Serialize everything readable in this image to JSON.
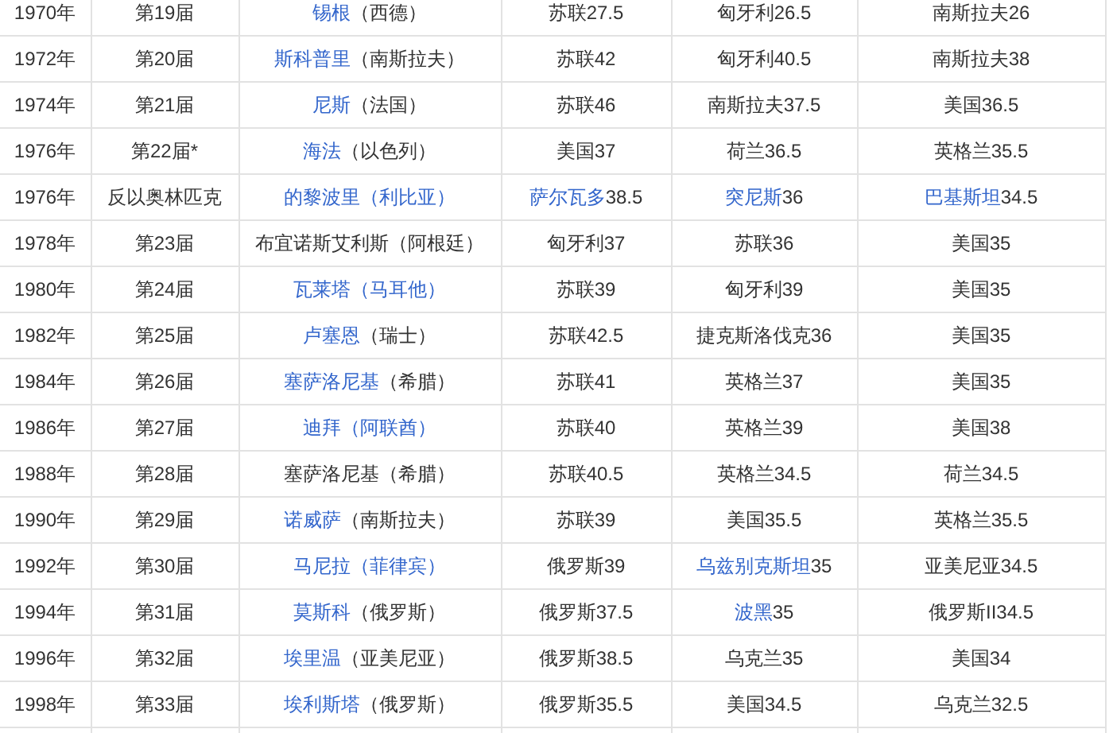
{
  "table": {
    "rows": [
      {
        "year": "1970年",
        "edition": "第19届",
        "city": "锡根",
        "city_link": true,
        "country": "（西德）",
        "country_link": false,
        "gold": {
          "team": "苏联",
          "score": "27.5",
          "link": false
        },
        "silver": {
          "team": "匈牙利",
          "score": "26.5",
          "link": false
        },
        "bronze": {
          "team": "南斯拉夫",
          "score": "26",
          "link": false
        }
      },
      {
        "year": "1972年",
        "edition": "第20届",
        "city": "斯科普里",
        "city_link": true,
        "country": "（南斯拉夫）",
        "country_link": false,
        "gold": {
          "team": "苏联",
          "score": "42",
          "link": false
        },
        "silver": {
          "team": "匈牙利",
          "score": "40.5",
          "link": false
        },
        "bronze": {
          "team": "南斯拉夫",
          "score": "38",
          "link": false
        }
      },
      {
        "year": "1974年",
        "edition": "第21届",
        "city": "尼斯",
        "city_link": true,
        "country": "（法国）",
        "country_link": false,
        "gold": {
          "team": "苏联",
          "score": "46",
          "link": false
        },
        "silver": {
          "team": "南斯拉夫",
          "score": "37.5",
          "link": false
        },
        "bronze": {
          "team": "美国",
          "score": "36.5",
          "link": false
        }
      },
      {
        "year": "1976年",
        "edition": "第22届*",
        "city": "海法",
        "city_link": true,
        "country": "（以色列）",
        "country_link": false,
        "gold": {
          "team": "美国",
          "score": "37",
          "link": false
        },
        "silver": {
          "team": "荷兰",
          "score": "36.5",
          "link": false
        },
        "bronze": {
          "team": "英格兰",
          "score": "35.5",
          "link": false
        }
      },
      {
        "year": "1976年",
        "edition": "反以奥林匹克",
        "city": "的黎波里",
        "city_link": true,
        "country": "（利比亚）",
        "country_link": true,
        "gold": {
          "team": "萨尔瓦多",
          "score": "38.5",
          "link": true
        },
        "silver": {
          "team": "突尼斯",
          "score": "36",
          "link": true
        },
        "bronze": {
          "team": "巴基斯坦",
          "score": "34.5",
          "link": true
        }
      },
      {
        "year": "1978年",
        "edition": "第23届",
        "city": "布宜诺斯艾利斯",
        "city_link": false,
        "country": "（阿根廷）",
        "country_link": false,
        "gold": {
          "team": "匈牙利",
          "score": "37",
          "link": false
        },
        "silver": {
          "team": "苏联",
          "score": "36",
          "link": false
        },
        "bronze": {
          "team": "美国",
          "score": "35",
          "link": false
        }
      },
      {
        "year": "1980年",
        "edition": "第24届",
        "city": "瓦莱塔",
        "city_link": true,
        "country": "（马耳他）",
        "country_link": true,
        "gold": {
          "team": "苏联",
          "score": "39",
          "link": false
        },
        "silver": {
          "team": "匈牙利",
          "score": "39",
          "link": false
        },
        "bronze": {
          "team": "美国",
          "score": "35",
          "link": false
        }
      },
      {
        "year": "1982年",
        "edition": "第25届",
        "city": "卢塞恩",
        "city_link": true,
        "country": "（瑞士）",
        "country_link": false,
        "gold": {
          "team": "苏联",
          "score": "42.5",
          "link": false
        },
        "silver": {
          "team": "捷克斯洛伐克",
          "score": "36",
          "link": false
        },
        "bronze": {
          "team": "美国",
          "score": "35",
          "link": false
        }
      },
      {
        "year": "1984年",
        "edition": "第26届",
        "city": "塞萨洛尼基",
        "city_link": true,
        "country": "（希腊）",
        "country_link": false,
        "gold": {
          "team": "苏联",
          "score": "41",
          "link": false
        },
        "silver": {
          "team": "英格兰",
          "score": "37",
          "link": false
        },
        "bronze": {
          "team": "美国",
          "score": "35",
          "link": false
        }
      },
      {
        "year": "1986年",
        "edition": "第27届",
        "city": "迪拜",
        "city_link": true,
        "country": "（阿联酋）",
        "country_link": true,
        "gold": {
          "team": "苏联",
          "score": "40",
          "link": false
        },
        "silver": {
          "team": "英格兰",
          "score": "39",
          "link": false
        },
        "bronze": {
          "team": "美国",
          "score": "38",
          "link": false
        }
      },
      {
        "year": "1988年",
        "edition": "第28届",
        "city": "塞萨洛尼基",
        "city_link": false,
        "country": "（希腊）",
        "country_link": false,
        "gold": {
          "team": "苏联",
          "score": "40.5",
          "link": false
        },
        "silver": {
          "team": "英格兰",
          "score": "34.5",
          "link": false
        },
        "bronze": {
          "team": "荷兰",
          "score": "34.5",
          "link": false
        }
      },
      {
        "year": "1990年",
        "edition": "第29届",
        "city": "诺威萨",
        "city_link": true,
        "country": "（南斯拉夫）",
        "country_link": false,
        "gold": {
          "team": "苏联",
          "score": "39",
          "link": false
        },
        "silver": {
          "team": "美国",
          "score": "35.5",
          "link": false
        },
        "bronze": {
          "team": "英格兰",
          "score": "35.5",
          "link": false
        }
      },
      {
        "year": "1992年",
        "edition": "第30届",
        "city": "马尼拉",
        "city_link": true,
        "country": "（菲律宾）",
        "country_link": true,
        "gold": {
          "team": "俄罗斯",
          "score": "39",
          "link": false
        },
        "silver": {
          "team": "乌兹别克斯坦",
          "score": "35",
          "link": true
        },
        "bronze": {
          "team": "亚美尼亚",
          "score": "34.5",
          "link": false
        }
      },
      {
        "year": "1994年",
        "edition": "第31届",
        "city": "莫斯科",
        "city_link": true,
        "country": "（俄罗斯）",
        "country_link": false,
        "gold": {
          "team": "俄罗斯",
          "score": "37.5",
          "link": false
        },
        "silver": {
          "team": "波黑",
          "score": "35",
          "link": true
        },
        "bronze": {
          "team": "俄罗斯II",
          "score": "34.5",
          "link": false
        }
      },
      {
        "year": "1996年",
        "edition": "第32届",
        "city": "埃里温",
        "city_link": true,
        "country": "（亚美尼亚）",
        "country_link": false,
        "gold": {
          "team": "俄罗斯",
          "score": "38.5",
          "link": false
        },
        "silver": {
          "team": "乌克兰",
          "score": "35",
          "link": false
        },
        "bronze": {
          "team": "美国",
          "score": "34",
          "link": false
        }
      },
      {
        "year": "1998年",
        "edition": "第33届",
        "city": "埃利斯塔",
        "city_link": true,
        "country": "（俄罗斯）",
        "country_link": false,
        "gold": {
          "team": "俄罗斯",
          "score": "35.5",
          "link": false
        },
        "silver": {
          "team": "美国",
          "score": "34.5",
          "link": false
        },
        "bronze": {
          "team": "乌克兰",
          "score": "32.5",
          "link": false
        }
      }
    ]
  }
}
